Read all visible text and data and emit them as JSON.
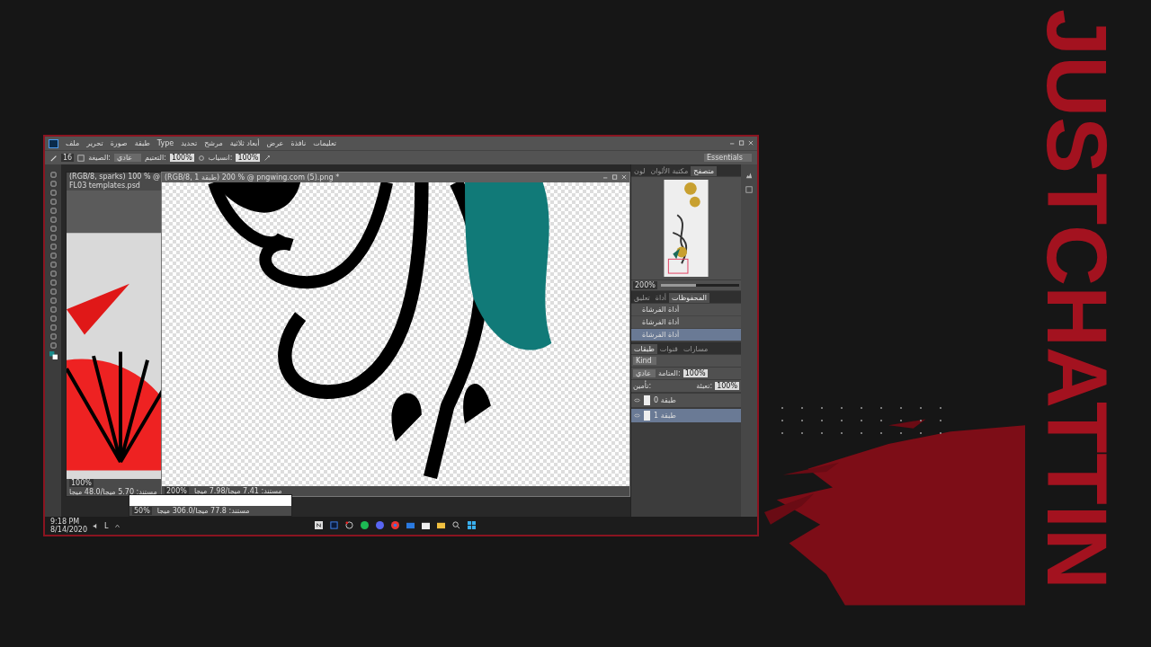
{
  "overlay": {
    "title": "JUSTCHATTIN"
  },
  "app": {
    "menu": [
      "تعليمات",
      "نافذة",
      "عرض",
      "أبعاد ثلاثية",
      "مرشح",
      "تحديد",
      "Type",
      "طبقة",
      "صورة",
      "تحرير",
      "ملف"
    ],
    "options": {
      "brush_size": "16",
      "mode_label": "الصيغة:",
      "mode": "عادي",
      "opacity_label": "التعتيم:",
      "opacity": "100%",
      "flow_label": "انسياب:",
      "flow": "100%"
    },
    "workspace": "Essentials",
    "documents": [
      {
        "kind": "floral",
        "title": "(RGB/8, 1 طبقة) 200 % @ pngwing.com (5).png *",
        "zoom": "200%",
        "status": "مستند: 7.41 ميجا/7.98 ميجا",
        "active": true
      },
      {
        "kind": "fan",
        "title": "(RGB/8, sparks) 100 % @ FL03 templates.psd",
        "zoom": "100%",
        "status": "مستند: 5.70 ميجا/48.0 ميجا",
        "active": false
      },
      {
        "kind": "blank",
        "zoom": "50%",
        "status": "مستند: 77.8 ميجا/306.0 ميجا",
        "active": false
      }
    ],
    "navigator": {
      "tabs": [
        {
          "label": "متصفح",
          "selected": true
        },
        {
          "label": "مكتبة الألوان",
          "selected": false
        },
        {
          "label": "لون",
          "selected": false
        }
      ],
      "zoom": "200%",
      "level": 0.45
    },
    "history": {
      "tabs": [
        {
          "label": "المحفوظات",
          "selected": true
        },
        {
          "label": "أداة",
          "selected": false
        },
        {
          "label": "تعليق",
          "selected": false
        }
      ],
      "items": [
        {
          "label": "أداة الفرشاة",
          "selected": false
        },
        {
          "label": "أداة الفرشاة",
          "selected": false
        },
        {
          "label": "أداة الفرشاة",
          "selected": true
        }
      ]
    },
    "layers": {
      "tabs": [
        {
          "label": "مسارات",
          "selected": false
        },
        {
          "label": "قنوات",
          "selected": false
        },
        {
          "label": "طبقات",
          "selected": true
        }
      ],
      "filter": "Kind",
      "blend_mode": "عادي",
      "opacity_label": "العتامة:",
      "opacity": "100%",
      "lock_label": "تأمين:",
      "fill_label": "تعبئة:",
      "fill": "100%",
      "items": [
        {
          "name": "طبقة 0",
          "selected": false
        },
        {
          "name": "طبقة 1",
          "selected": true
        }
      ]
    }
  },
  "taskbar": {
    "time": "9:18 PM",
    "date": "8/14/2020",
    "language": "L"
  }
}
